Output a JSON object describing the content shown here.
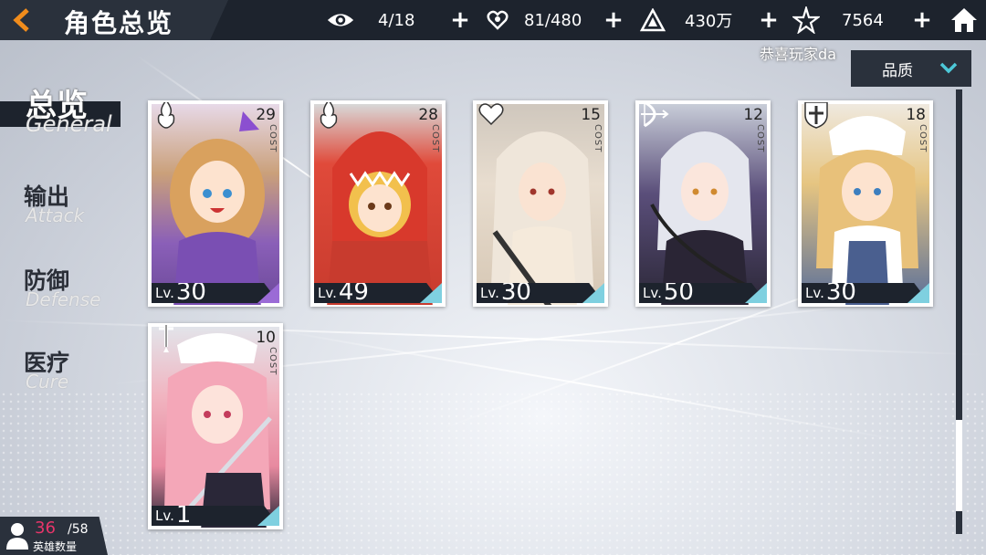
{
  "header": {
    "title": "角色总览",
    "stats": [
      {
        "icon": "eye-icon",
        "value": "4/18"
      },
      {
        "icon": "heart-hand-icon",
        "value": "81/480"
      },
      {
        "icon": "gold-pyramid-icon",
        "value": "430万"
      },
      {
        "icon": "star-crystal-icon",
        "value": "7564"
      }
    ]
  },
  "player_name": "恭喜玩家da",
  "sort": {
    "label": "品质"
  },
  "nav": [
    {
      "zh": "总览",
      "en": "General",
      "active": true
    },
    {
      "zh": "输出",
      "en": "Attack",
      "active": false
    },
    {
      "zh": "防御",
      "en": "Defense",
      "active": false
    },
    {
      "zh": "医疗",
      "en": "Cure",
      "active": false
    }
  ],
  "level_prefix": "Lv.",
  "cost_label": "COST",
  "characters": [
    {
      "cost": "29",
      "level": "30",
      "class_icon": "fire-icon",
      "rarity_color": "#9b6bd6"
    },
    {
      "cost": "28",
      "level": "49",
      "class_icon": "fire-icon",
      "rarity_color": "#7fd0e0"
    },
    {
      "cost": "15",
      "level": "30",
      "class_icon": "heart-icon",
      "rarity_color": "#7fd0e0"
    },
    {
      "cost": "12",
      "level": "50",
      "class_icon": "bow-icon",
      "rarity_color": "#7fd0e0"
    },
    {
      "cost": "18",
      "level": "30",
      "class_icon": "cross-shield-icon",
      "rarity_color": "#7fd0e0"
    },
    {
      "cost": "10",
      "level": "1",
      "class_icon": "sword-icon",
      "rarity_color": "#7fd0e0"
    }
  ],
  "hero_count": {
    "current": "36",
    "max": "/58",
    "label": "英雄数量"
  }
}
